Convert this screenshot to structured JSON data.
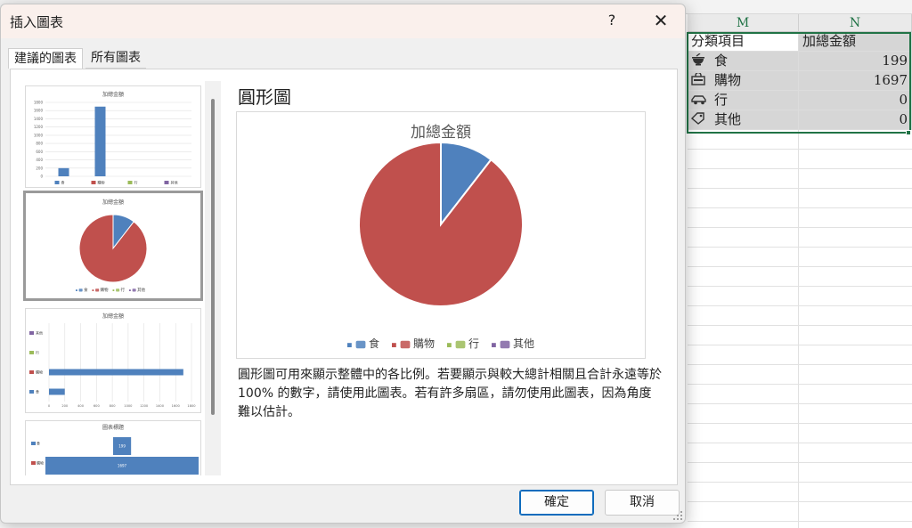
{
  "dialog": {
    "title": "插入圖表",
    "help_label": "?",
    "close_label": "✕",
    "tabs": [
      {
        "label": "建議的圖表",
        "active": true
      },
      {
        "label": "所有圖表",
        "active": false
      }
    ],
    "ok_label": "確定",
    "cancel_label": "取消"
  },
  "preview": {
    "chart_type_name": "圓形圖",
    "description": "圓形圖可用來顯示整體中的各比例。若要顯示與較大總計相關且合計永遠等於 100% 的數字，請使用此圖表。若有許多扇區，請勿使用此圖表，因為角度難以估計。"
  },
  "thumbnails": {
    "chart_titles": [
      "加總金額",
      "加總金額",
      "加總金額",
      "圖表標題"
    ],
    "column_yticks": [
      "1800",
      "1600",
      "1400",
      "1200",
      "1000",
      "800",
      "600",
      "400",
      "200",
      "0"
    ],
    "bar_xticks": [
      "0",
      "200",
      "400",
      "600",
      "800",
      "1000",
      "1200",
      "1400",
      "1600",
      "1800"
    ],
    "bar_value_labels": [
      "199",
      "1697"
    ]
  },
  "sheet": {
    "columns": [
      "M",
      "N"
    ],
    "header": {
      "category": "分類項目",
      "amount": "加總金額"
    },
    "rows": [
      {
        "icon": "bowl-icon",
        "category": "食",
        "amount": "199"
      },
      {
        "icon": "shopping-bag-icon",
        "category": "購物",
        "amount": "1697"
      },
      {
        "icon": "car-icon",
        "category": "行",
        "amount": "0"
      },
      {
        "icon": "tag-icon",
        "category": "其他",
        "amount": "0"
      }
    ]
  },
  "chart_data": {
    "type": "pie",
    "title": "加總金額",
    "categories": [
      "食",
      "購物",
      "行",
      "其他"
    ],
    "values": [
      199,
      1697,
      0,
      0
    ],
    "colors": [
      "#4f81bd",
      "#c0504d",
      "#9bbb59",
      "#8064a2"
    ],
    "legend_position": "bottom"
  }
}
